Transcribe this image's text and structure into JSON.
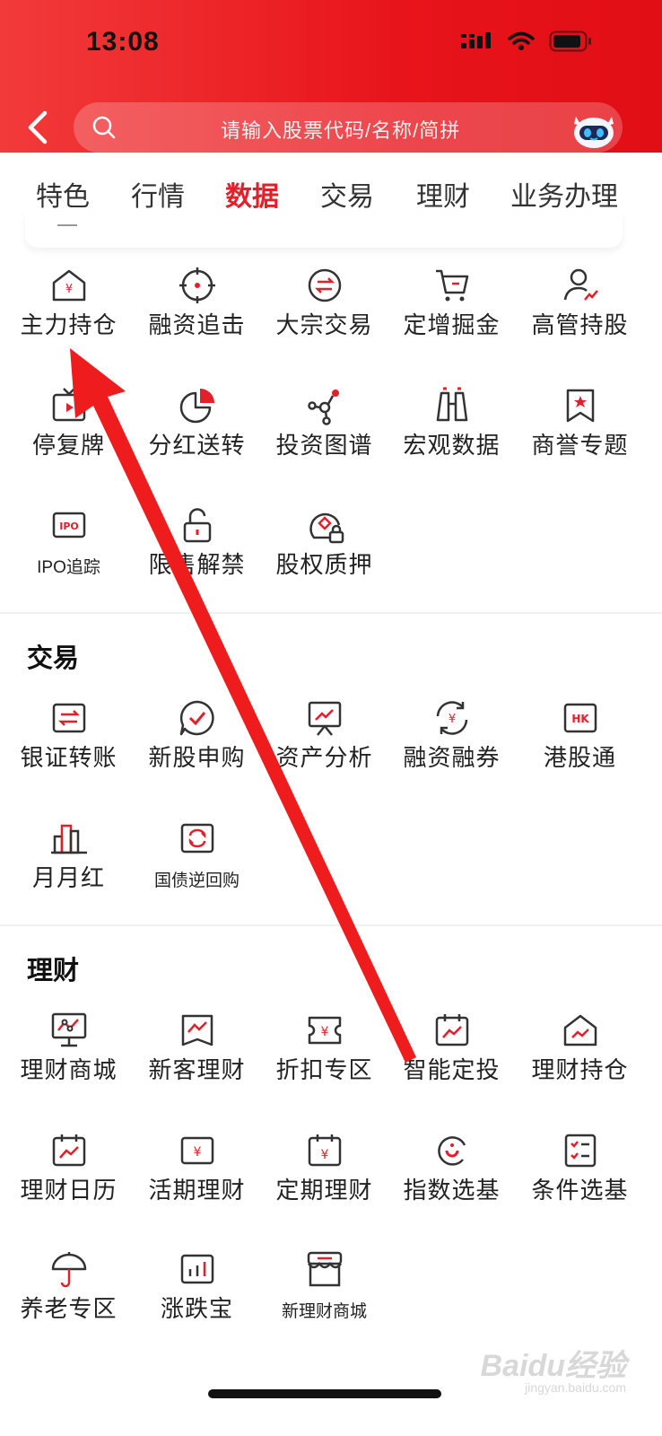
{
  "status_bar": {
    "time": "13:08"
  },
  "search": {
    "placeholder": "请输入股票代码/名称/简拼"
  },
  "tabs": [
    "特色",
    "行情",
    "数据",
    "交易",
    "理财",
    "业务办理"
  ],
  "active_tab": "数据",
  "data_items": [
    {
      "label": "主力持仓",
      "icon": "house-yen-icon"
    },
    {
      "label": "融资追击",
      "icon": "target-icon"
    },
    {
      "label": "大宗交易",
      "icon": "exchange-circle-icon"
    },
    {
      "label": "定增掘金",
      "icon": "cart-icon"
    },
    {
      "label": "高管持股",
      "icon": "person-chart-icon"
    },
    {
      "label": "停复牌",
      "icon": "tv-play-icon"
    },
    {
      "label": "分红送转",
      "icon": "pie-chart-icon"
    },
    {
      "label": "投资图谱",
      "icon": "graph-nodes-icon"
    },
    {
      "label": "宏观数据",
      "icon": "binoculars-icon"
    },
    {
      "label": "商誉专题",
      "icon": "bookmark-star-icon"
    },
    {
      "label": "IPO追踪",
      "icon": "ipo-icon"
    },
    {
      "label": "限售解禁",
      "icon": "unlock-icon"
    },
    {
      "label": "股权质押",
      "icon": "pledge-lock-icon"
    }
  ],
  "trade_section": {
    "title": "交易",
    "items": [
      {
        "label": "银证转账",
        "icon": "transfer-icon"
      },
      {
        "label": "新股申购",
        "icon": "chat-check-icon"
      },
      {
        "label": "资产分析",
        "icon": "presentation-icon"
      },
      {
        "label": "融资融券",
        "icon": "yen-cycle-icon"
      },
      {
        "label": "港股通",
        "icon": "hk-icon"
      },
      {
        "label": "月月红",
        "icon": "buildings-icon"
      },
      {
        "label": "国债逆回购",
        "icon": "repo-icon"
      }
    ]
  },
  "wealth_section": {
    "title": "理财",
    "items": [
      {
        "label": "理财商城",
        "icon": "monitor-chart-icon"
      },
      {
        "label": "新客理财",
        "icon": "trend-card-icon"
      },
      {
        "label": "折扣专区",
        "icon": "ticket-yen-icon"
      },
      {
        "label": "智能定投",
        "icon": "calendar-trend-icon"
      },
      {
        "label": "理财持仓",
        "icon": "house-trend-icon"
      },
      {
        "label": "理财日历",
        "icon": "calendar-chart-icon"
      },
      {
        "label": "活期理财",
        "icon": "yen-card-icon"
      },
      {
        "label": "定期理财",
        "icon": "calendar-yen-icon"
      },
      {
        "label": "指数选基",
        "icon": "cycle-icon"
      },
      {
        "label": "条件选基",
        "icon": "checklist-icon"
      },
      {
        "label": "养老专区",
        "icon": "umbrella-icon"
      },
      {
        "label": "涨跌宝",
        "icon": "bar-card-icon"
      },
      {
        "label": "新理财商城",
        "icon": "store-icon"
      }
    ]
  },
  "watermark": {
    "text": "Baidu经验",
    "sub": "jingyan.baidu.com"
  },
  "colors": {
    "brand_red": "#e3202a",
    "header_red": "#e8141b"
  }
}
